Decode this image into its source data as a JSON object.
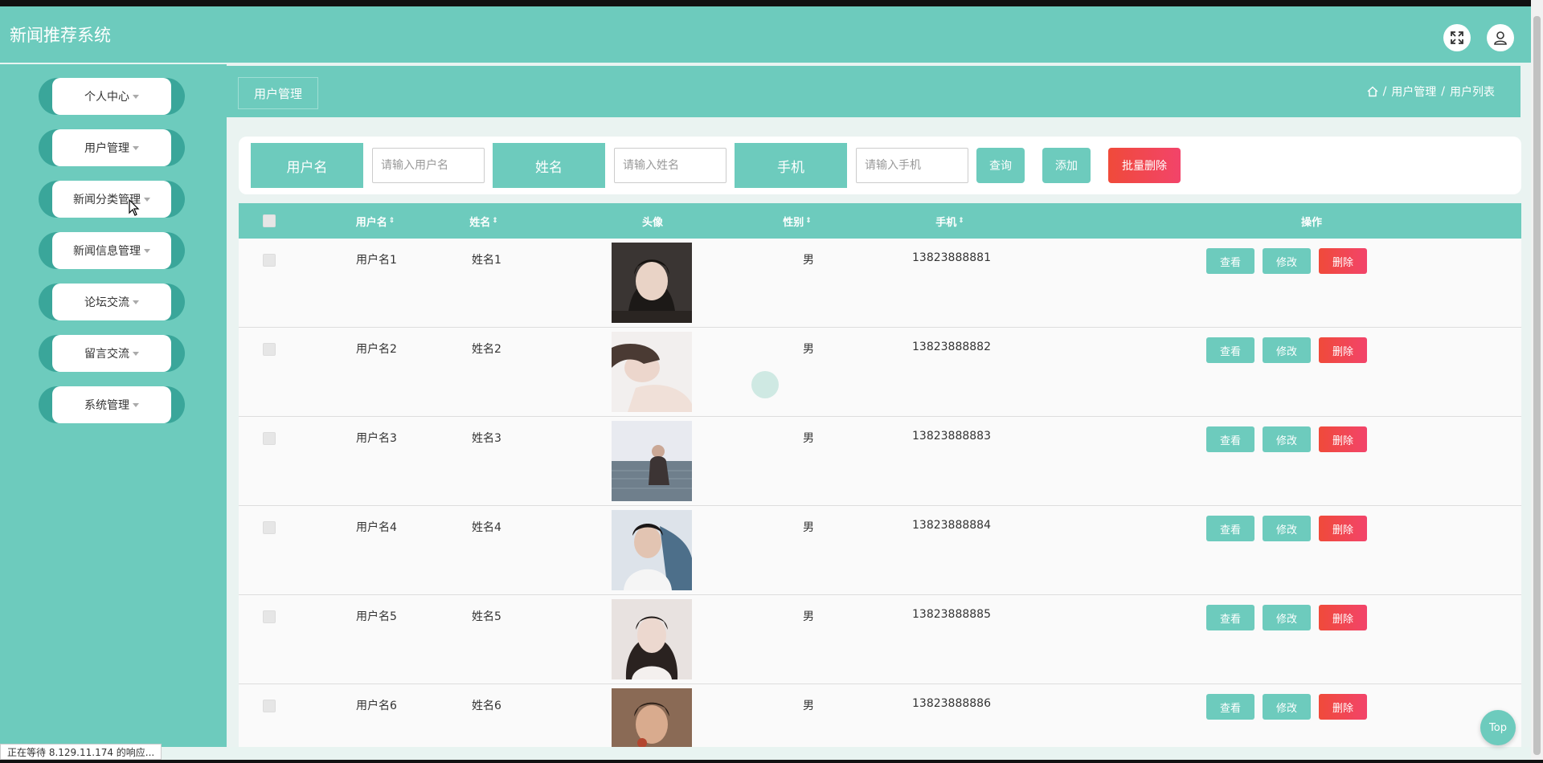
{
  "app": {
    "title": "新闻推荐系统"
  },
  "header": {
    "icons": [
      "fullscreen-icon",
      "user-icon"
    ]
  },
  "sidebar": {
    "items": [
      {
        "label": "个人中心"
      },
      {
        "label": "用户管理"
      },
      {
        "label": "新闻分类管理"
      },
      {
        "label": "新闻信息管理"
      },
      {
        "label": "论坛交流"
      },
      {
        "label": "留言交流"
      },
      {
        "label": "系统管理"
      }
    ]
  },
  "page": {
    "tab": "用户管理",
    "breadcrumb": [
      "用户管理",
      "用户列表"
    ]
  },
  "search": {
    "username_label": "用户名",
    "username_placeholder": "请输入用户名",
    "name_label": "姓名",
    "name_placeholder": "请输入姓名",
    "phone_label": "手机",
    "phone_placeholder": "请输入手机",
    "query_button": "查询",
    "add_button": "添加",
    "batch_delete_button": "批量删除"
  },
  "table": {
    "headers": {
      "username": "用户名",
      "name": "姓名",
      "avatar": "头像",
      "gender": "性别",
      "phone": "手机",
      "actions": "操作"
    },
    "action_labels": {
      "view": "查看",
      "edit": "修改",
      "delete": "删除"
    },
    "rows": [
      {
        "username": "用户名1",
        "name": "姓名1",
        "gender": "男",
        "phone": "13823888881"
      },
      {
        "username": "用户名2",
        "name": "姓名2",
        "gender": "男",
        "phone": "13823888882"
      },
      {
        "username": "用户名3",
        "name": "姓名3",
        "gender": "男",
        "phone": "13823888883"
      },
      {
        "username": "用户名4",
        "name": "姓名4",
        "gender": "男",
        "phone": "13823888884"
      },
      {
        "username": "用户名5",
        "name": "姓名5",
        "gender": "男",
        "phone": "13823888885"
      },
      {
        "username": "用户名6",
        "name": "姓名6",
        "gender": "男",
        "phone": "13823888886"
      }
    ]
  },
  "top_button": "Top",
  "status_bar": "正在等待 8.129.11.174 的响应...",
  "colors": {
    "primary": "#6dcbbd",
    "danger": "#f04a3a"
  }
}
